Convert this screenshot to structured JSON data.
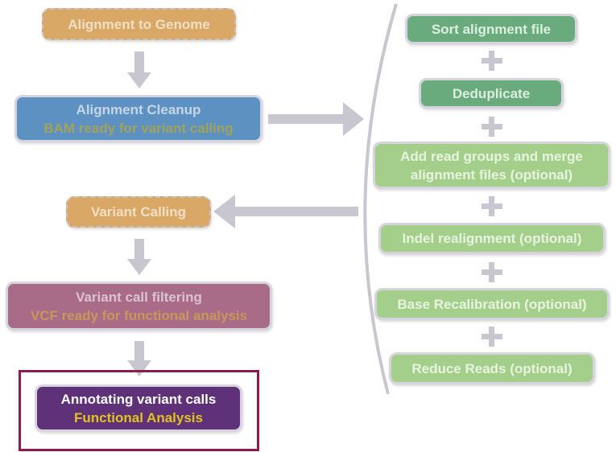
{
  "left_flow": {
    "alignment_to_genome": "Alignment to Genome",
    "alignment_cleanup": {
      "title": "Alignment Cleanup",
      "subtitle": "BAM ready for variant calling"
    },
    "variant_calling": "Variant Calling",
    "variant_call_filtering": {
      "title": "Variant call filtering",
      "subtitle": "VCF ready for functional analysis"
    },
    "annotating": {
      "title": "Annotating variant calls",
      "subtitle": "Functional Analysis"
    }
  },
  "cleanup_steps": [
    "Sort alignment file",
    "Deduplicate",
    "Add read groups and merge alignment files (optional)",
    "Indel realignment (optional)",
    "Base Recalibration (optional)",
    "Reduce Reads (optional)"
  ],
  "colors": {
    "orange": "#d9a866",
    "blue": "#5d91c1",
    "pink": "#a86b88",
    "purple": "#5e3179",
    "dark_green": "#6aab7e",
    "light_green": "#a4cf8b",
    "arrow": "#c8c6d0",
    "highlight": "#8c1b4e"
  }
}
